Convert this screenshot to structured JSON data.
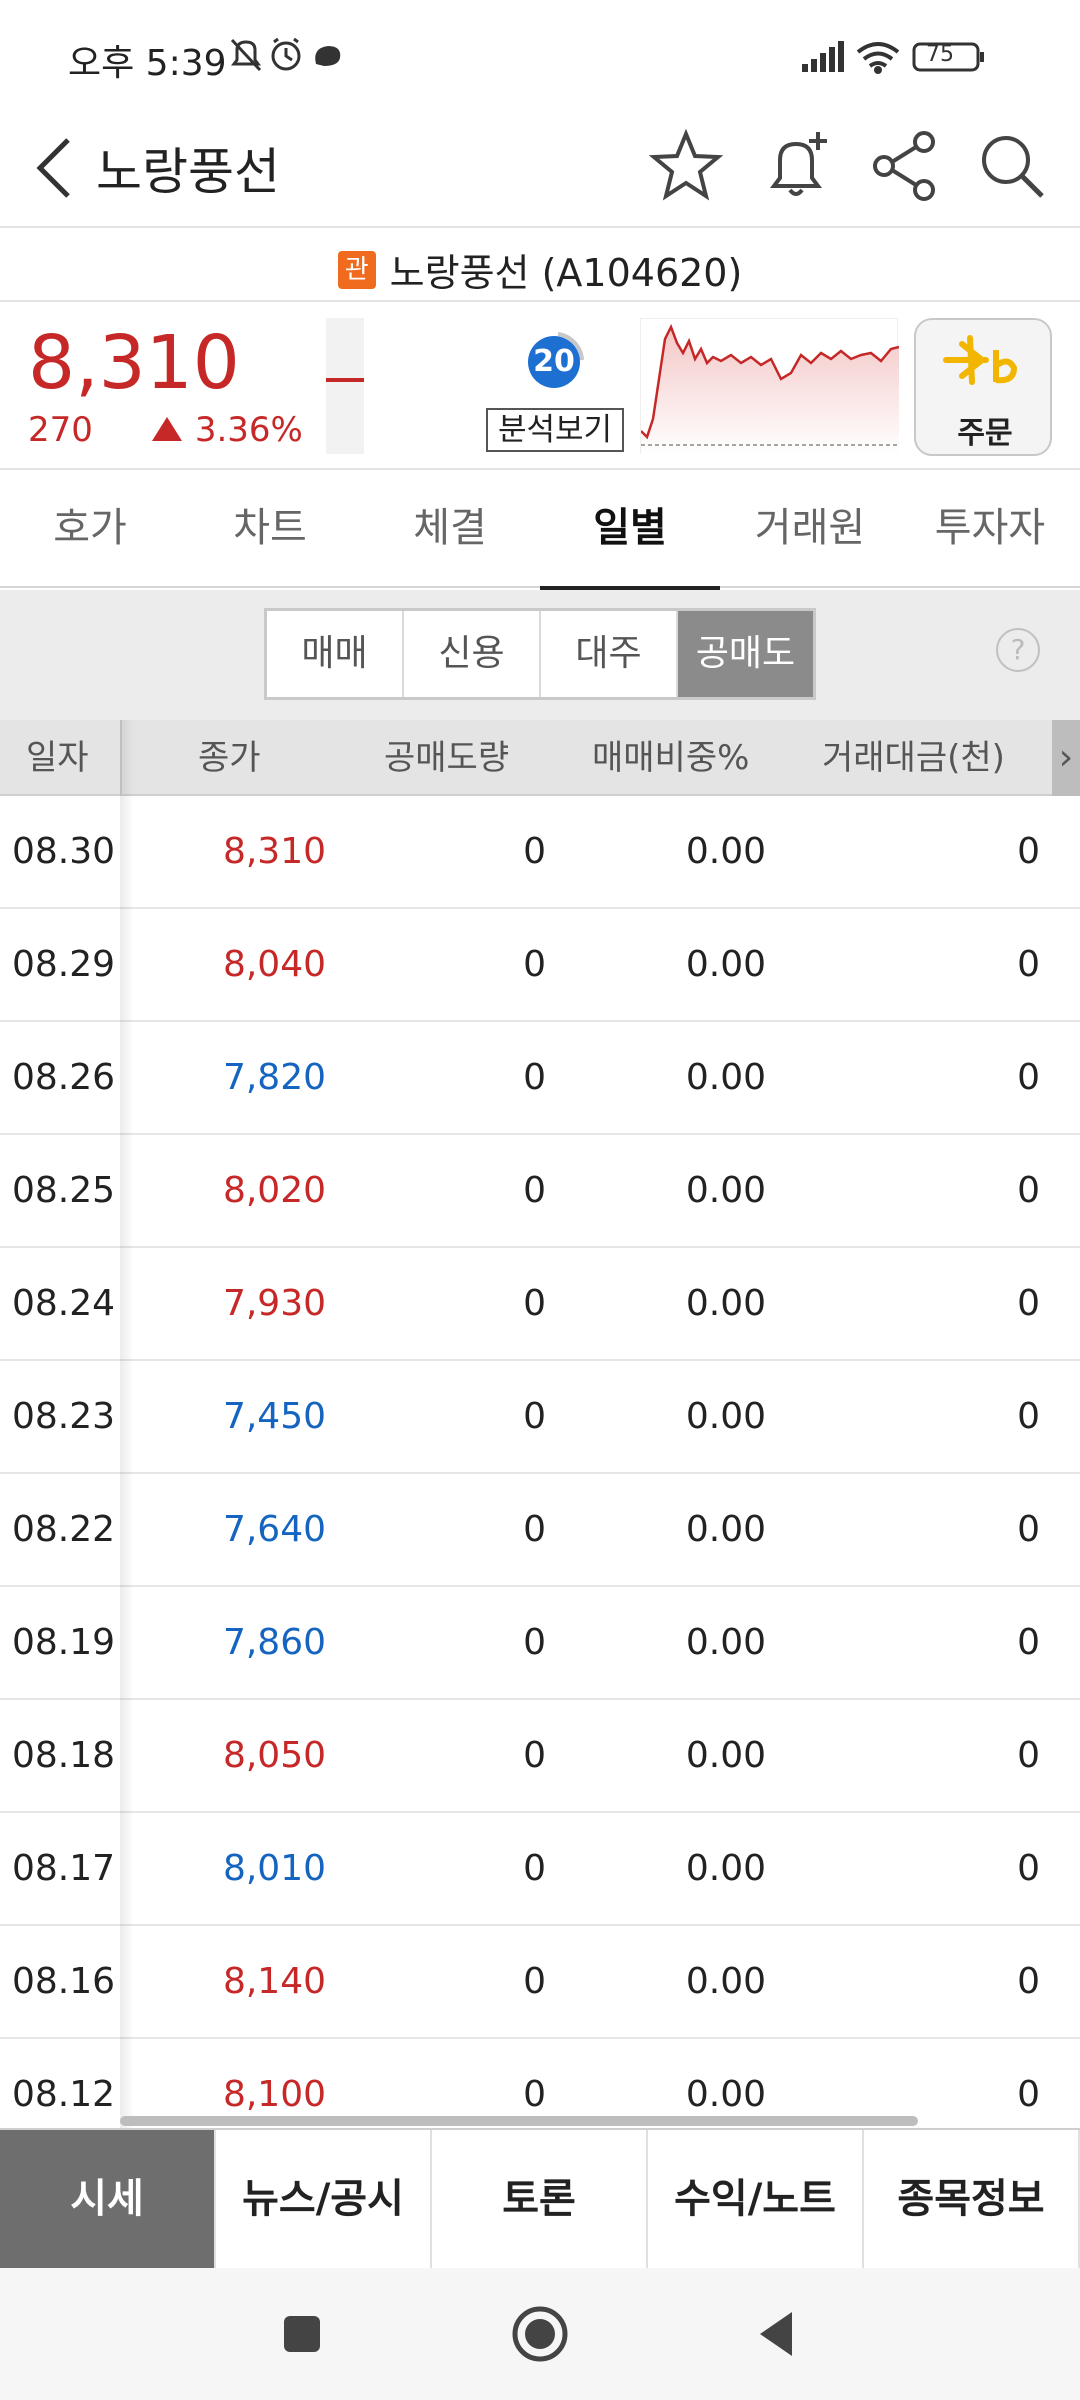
{
  "status_bar": {
    "time": "오후 5:39",
    "battery": "75",
    "icons_left": [
      "mute-bell-icon",
      "alarm-icon",
      "app-notification-icon"
    ],
    "icons_right": [
      "signal-icon",
      "wifi-icon",
      "battery-icon"
    ]
  },
  "header": {
    "title": "노랑풍선",
    "icons": [
      "back-icon",
      "star-icon",
      "bell-plus-icon",
      "share-icon",
      "search-icon"
    ]
  },
  "stock": {
    "badge": "관",
    "name_code": "노랑풍선 (A104620)",
    "price": "8,310",
    "change": "270",
    "change_pct": "3.36%",
    "direction": "up",
    "analysis_score": "20",
    "analysis_label": "분석보기",
    "order_label": "주문",
    "up_color": "#c62828",
    "down_color": "#1565c0"
  },
  "tabs": [
    {
      "label": "호가",
      "active": false
    },
    {
      "label": "차트",
      "active": false
    },
    {
      "label": "체결",
      "active": false
    },
    {
      "label": "일별",
      "active": true
    },
    {
      "label": "거래원",
      "active": false
    },
    {
      "label": "투자자",
      "active": false
    }
  ],
  "segments": [
    {
      "label": "매매",
      "active": false
    },
    {
      "label": "신용",
      "active": false
    },
    {
      "label": "대주",
      "active": false
    },
    {
      "label": "공매도",
      "active": true
    }
  ],
  "help": "?",
  "table": {
    "columns": [
      "일자",
      "종가",
      "공매도량",
      "매매비중%",
      "거래대금(천)"
    ],
    "more": "›",
    "rows": [
      {
        "date": "08.30",
        "close": "8,310",
        "dir": "up",
        "short": "0",
        "ratio": "0.00",
        "amount": "0"
      },
      {
        "date": "08.29",
        "close": "8,040",
        "dir": "up",
        "short": "0",
        "ratio": "0.00",
        "amount": "0"
      },
      {
        "date": "08.26",
        "close": "7,820",
        "dir": "down",
        "short": "0",
        "ratio": "0.00",
        "amount": "0"
      },
      {
        "date": "08.25",
        "close": "8,020",
        "dir": "up",
        "short": "0",
        "ratio": "0.00",
        "amount": "0"
      },
      {
        "date": "08.24",
        "close": "7,930",
        "dir": "up",
        "short": "0",
        "ratio": "0.00",
        "amount": "0"
      },
      {
        "date": "08.23",
        "close": "7,450",
        "dir": "down",
        "short": "0",
        "ratio": "0.00",
        "amount": "0"
      },
      {
        "date": "08.22",
        "close": "7,640",
        "dir": "down",
        "short": "0",
        "ratio": "0.00",
        "amount": "0"
      },
      {
        "date": "08.19",
        "close": "7,860",
        "dir": "down",
        "short": "0",
        "ratio": "0.00",
        "amount": "0"
      },
      {
        "date": "08.18",
        "close": "8,050",
        "dir": "up",
        "short": "0",
        "ratio": "0.00",
        "amount": "0"
      },
      {
        "date": "08.17",
        "close": "8,010",
        "dir": "down",
        "short": "0",
        "ratio": "0.00",
        "amount": "0"
      },
      {
        "date": "08.16",
        "close": "8,140",
        "dir": "up",
        "short": "0",
        "ratio": "0.00",
        "amount": "0"
      },
      {
        "date": "08.12",
        "close": "8,100",
        "dir": "up",
        "short": "0",
        "ratio": "0.00",
        "amount": "0"
      }
    ]
  },
  "bottom_tabs": [
    {
      "label": "시세",
      "active": true
    },
    {
      "label": "뉴스/공시",
      "active": false
    },
    {
      "label": "토론",
      "active": false
    },
    {
      "label": "수익/노트",
      "active": false
    },
    {
      "label": "종목정보",
      "active": false
    }
  ],
  "navbar": [
    "recents-icon",
    "home-icon",
    "back-nav-icon"
  ]
}
